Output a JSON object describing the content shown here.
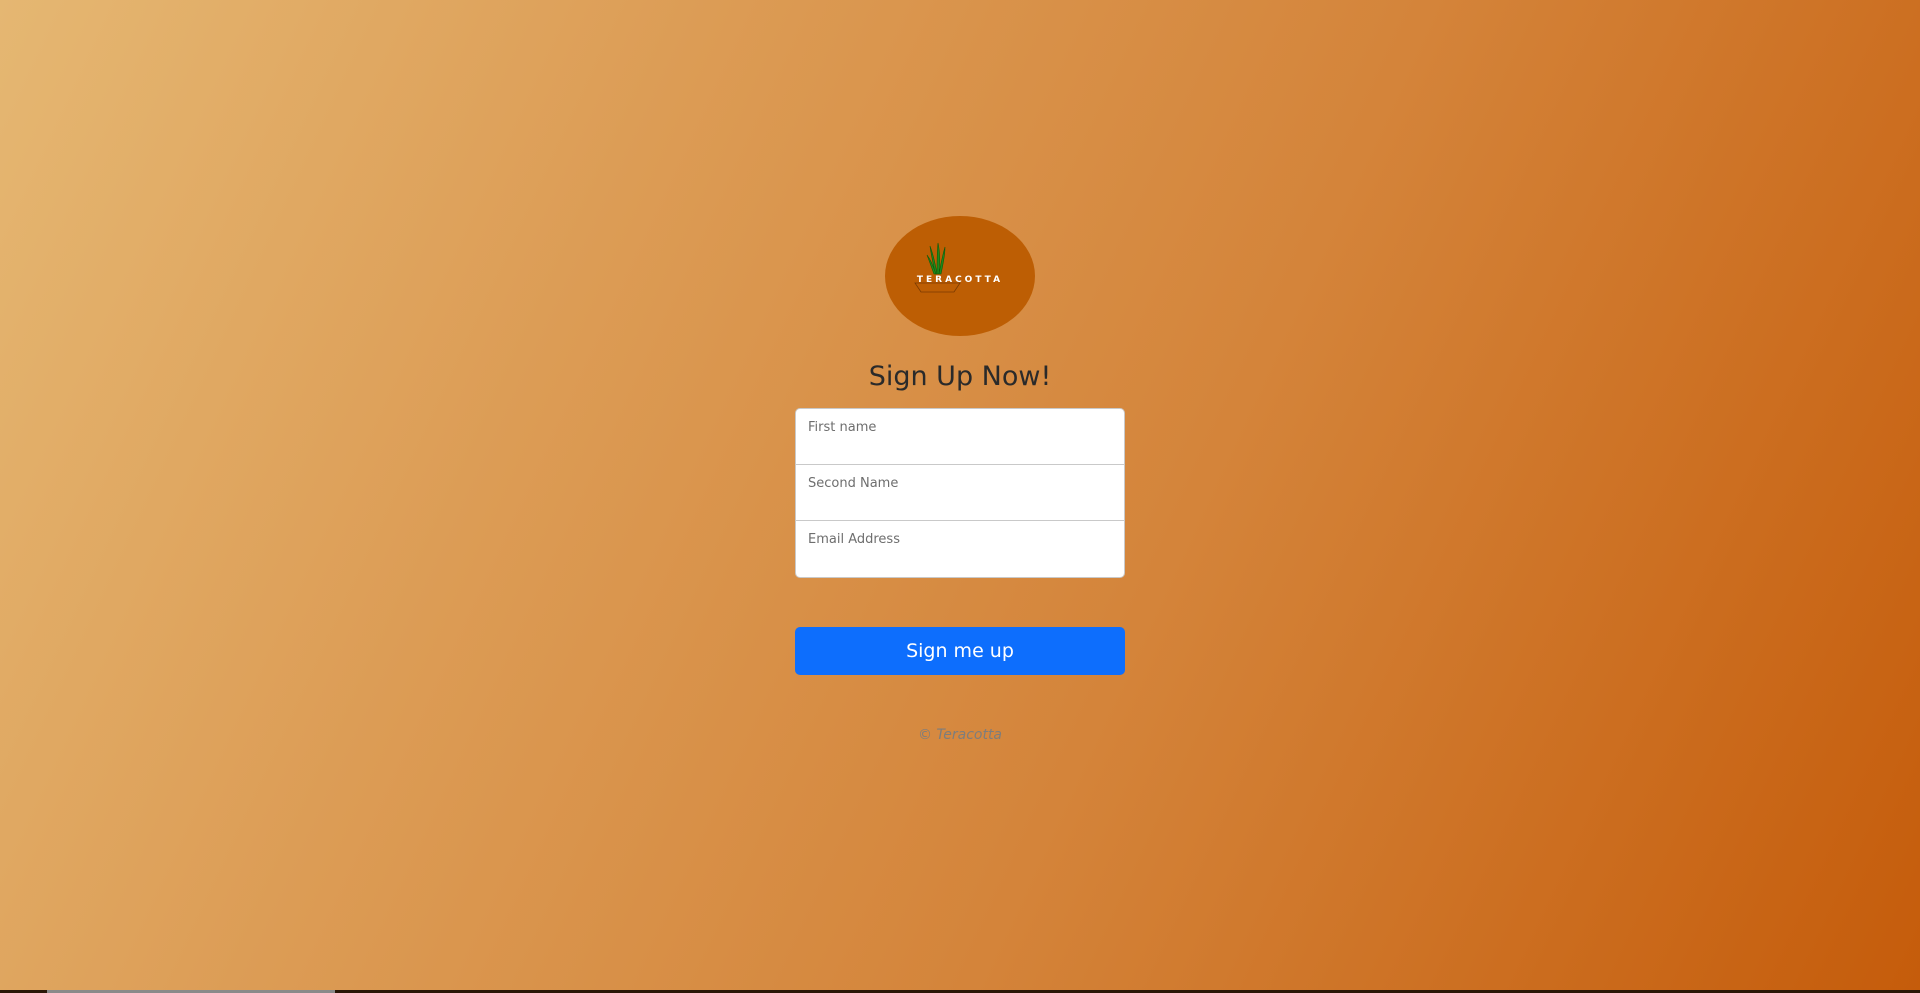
{
  "brand": {
    "logo_text": "TERACOTTA",
    "logo_color": "#bd5e04"
  },
  "page": {
    "title": "Sign Up Now!"
  },
  "form": {
    "fields": [
      {
        "label": "First name",
        "value": ""
      },
      {
        "label": "Second Name",
        "value": ""
      },
      {
        "label": "Email Address",
        "value": ""
      }
    ],
    "submit_label": "Sign me up",
    "accent_color": "#0d6efd"
  },
  "footer": {
    "text": "© Teracotta"
  }
}
